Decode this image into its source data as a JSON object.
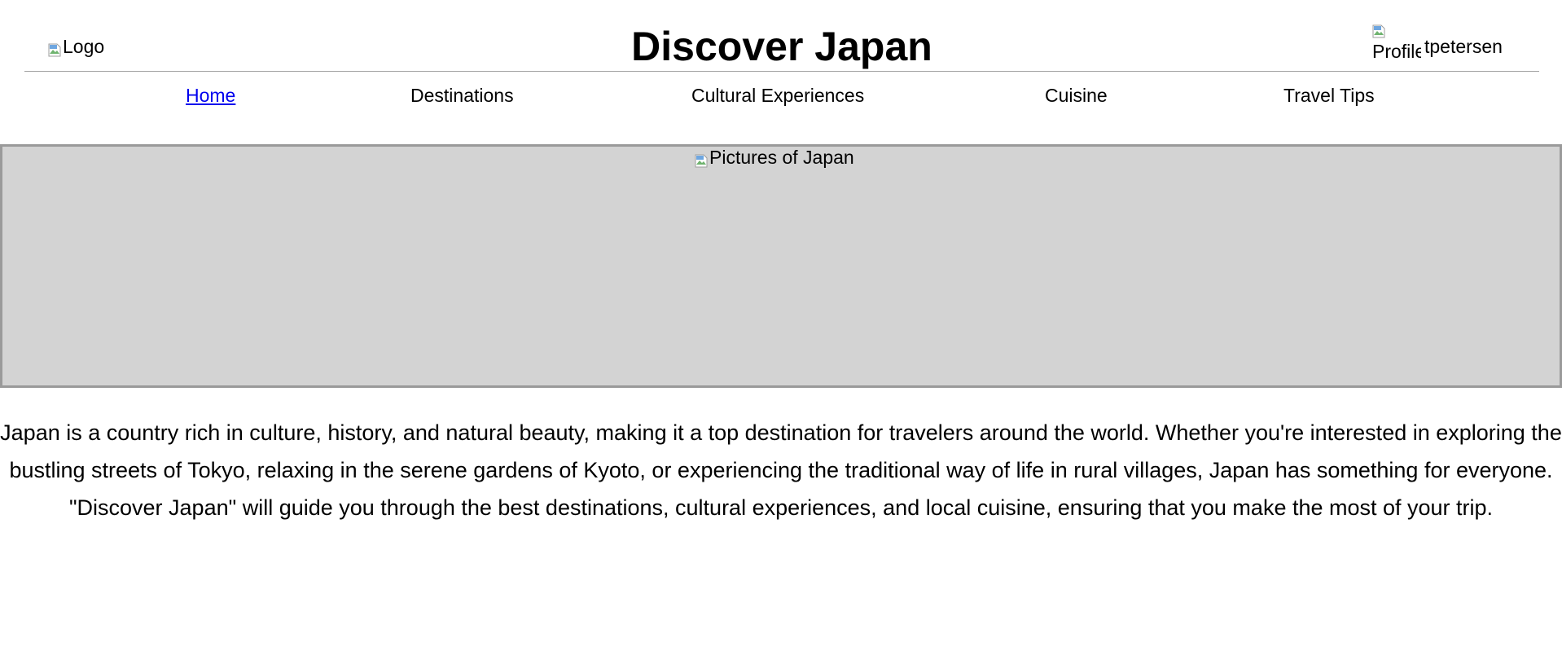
{
  "header": {
    "logo_alt": "Logo",
    "title": "Discover Japan",
    "profile": {
      "avatar_alt": "Profile",
      "username": "tpetersen"
    }
  },
  "nav": {
    "items": [
      {
        "label": "Home",
        "active": true
      },
      {
        "label": "Destinations",
        "active": false
      },
      {
        "label": "Cultural Experiences",
        "active": false
      },
      {
        "label": "Cuisine",
        "active": false
      },
      {
        "label": "Travel Tips",
        "active": false
      }
    ]
  },
  "hero": {
    "image_alt": "Pictures of Japan",
    "background_color": "#d3d3d3"
  },
  "intro": {
    "text": "Japan is a country rich in culture, history, and natural beauty, making it a top destination for travelers around the world. Whether you're interested in exploring the bustling streets of Tokyo, relaxing in the serene gardens of Kyoto, or experiencing the traditional way of life in rural villages, Japan has something for everyone. \"Discover Japan\" will guide you through the best destinations, cultural experiences, and local cuisine, ensuring that you make the most of your trip."
  },
  "colors": {
    "link_active": "#0000ee",
    "divider": "#a0a0a0",
    "hero_border": "#9a9a9a"
  },
  "icons": {
    "broken_image": "broken-image-icon"
  }
}
